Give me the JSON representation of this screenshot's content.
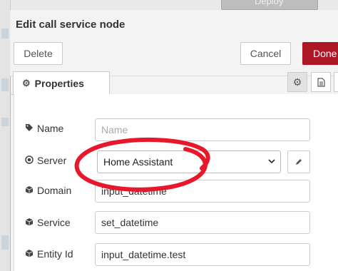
{
  "workspace": {
    "deploy_label": "Deploy"
  },
  "tray": {
    "title": "Edit call service node",
    "delete_label": "Delete",
    "cancel_label": "Cancel",
    "done_label": "Done",
    "tabs": {
      "properties_label": "Properties"
    }
  },
  "form": {
    "name": {
      "label": "Name",
      "placeholder": "Name",
      "value": ""
    },
    "server": {
      "label": "Server",
      "selected": "Home Assistant"
    },
    "domain": {
      "label": "Domain",
      "value": "input_datetime"
    },
    "service": {
      "label": "Service",
      "value": "set_datetime"
    },
    "entity_id": {
      "label": "Entity Id",
      "value": "input_datetime.test"
    }
  },
  "annotation": {
    "color": "#e8182c"
  },
  "colors": {
    "done_button": "#ad1625"
  }
}
